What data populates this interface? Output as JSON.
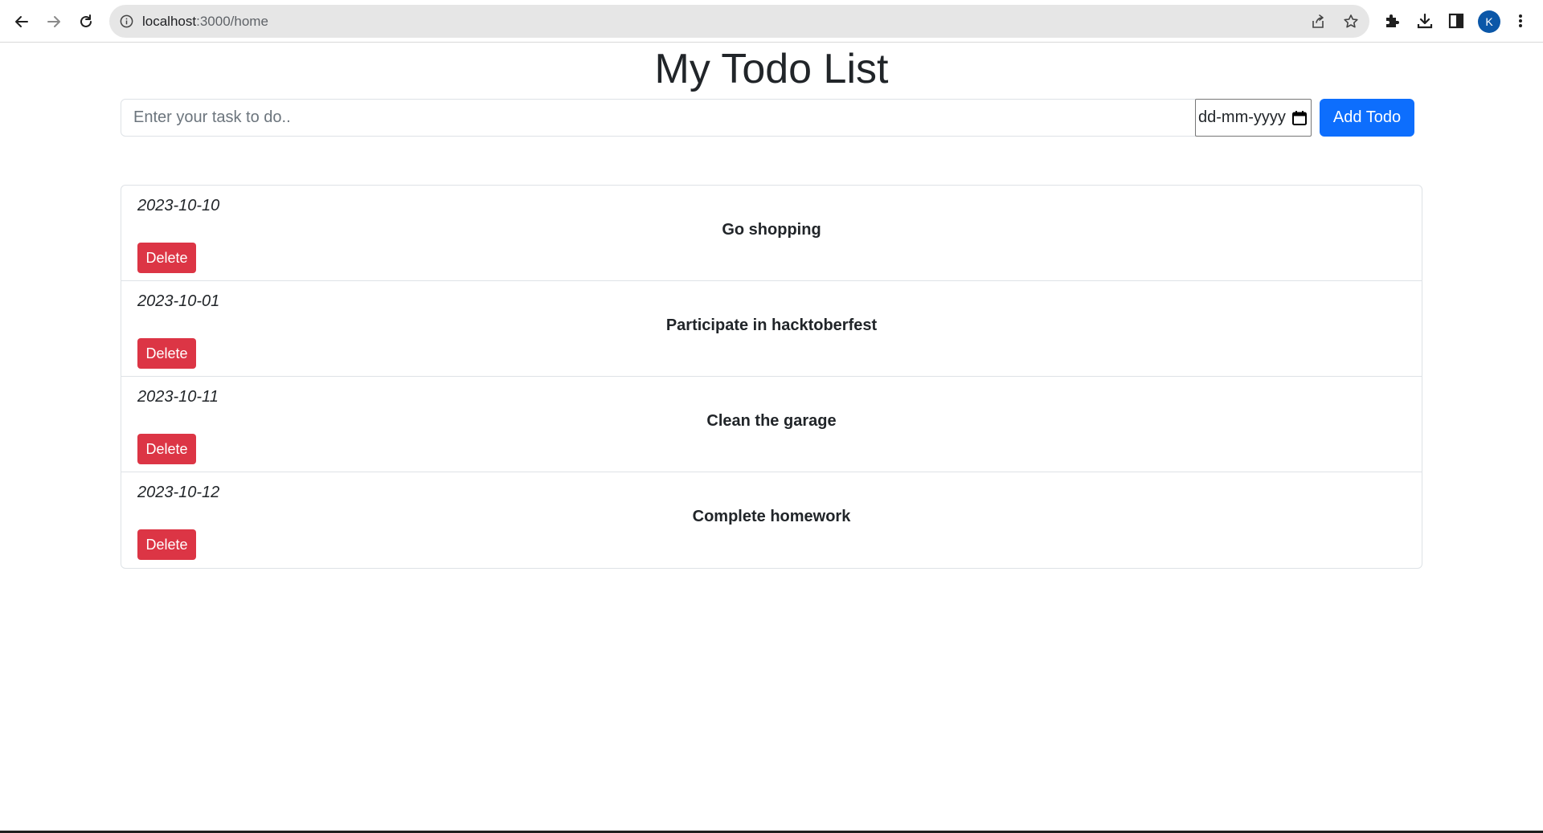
{
  "browser": {
    "url_host": "localhost",
    "url_path": ":3000/home",
    "profile_initial": "K"
  },
  "page": {
    "title": "My Todo List",
    "task_placeholder": "Enter your task to do..",
    "date_placeholder": "dd-mm-yyyy",
    "add_button": "Add Todo"
  },
  "todos": [
    {
      "date": "2023-10-10",
      "text": "Go shopping",
      "delete_label": "Delete"
    },
    {
      "date": "2023-10-01",
      "text": "Participate in hacktoberfest",
      "delete_label": "Delete"
    },
    {
      "date": "2023-10-11",
      "text": "Clean the garage",
      "delete_label": "Delete"
    },
    {
      "date": "2023-10-12",
      "text": "Complete homework",
      "delete_label": "Delete"
    }
  ],
  "colors": {
    "primary": "#0d6efd",
    "danger": "#dc3545",
    "text": "#212529",
    "border": "#dee2e6"
  },
  "icons": {
    "toolbar": [
      "back-arrow-icon",
      "forward-arrow-icon",
      "reload-icon",
      "site-info-icon",
      "share-icon",
      "bookmark-star-icon",
      "extensions-puzzle-icon",
      "download-icon",
      "side-panel-icon",
      "menu-dots-icon"
    ],
    "page": [
      "calendar-icon"
    ]
  }
}
